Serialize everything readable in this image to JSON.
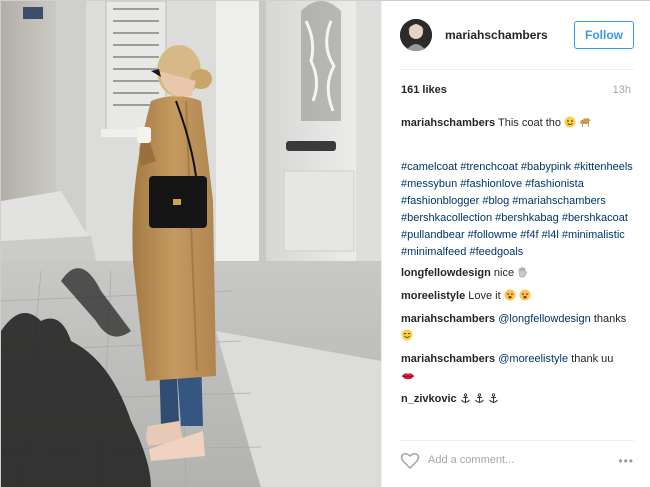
{
  "post": {
    "username": "mariahschambers",
    "follow_label": "Follow",
    "likes": "161 likes",
    "time": "13h",
    "caption": {
      "user": "mariahschambers",
      "text": "This coat tho"
    },
    "hashtags": "#camelcoat #trenchcoat #babypink #kittenheels #messybun #fashionlove #fashionista #fashionblogger #blog #mariahschambers #bershkacollection #bershkabag #bershkacoat #pullandbear #followme #f4f #l4l #minimalistic #minimalfeed #feedgoals",
    "comments": [
      {
        "user": "longfellowdesign",
        "text": "nice"
      },
      {
        "user": "moreelistyle",
        "text": "Love it"
      },
      {
        "user": "mariahschambers",
        "mention": "@longfellowdesign",
        "text": "thanks"
      },
      {
        "user": "mariahschambers",
        "mention": "@moreelistyle",
        "text": "thank uu"
      },
      {
        "user": "n_zivkovic",
        "text": ""
      }
    ],
    "add_comment_placeholder": "Add a comment...",
    "more_label": "•••"
  },
  "colors": {
    "link": "#003569",
    "follow": "#3897f0",
    "muted": "#a5a5a5"
  },
  "icons": [
    "heart-icon",
    "more-icon",
    "avatar"
  ]
}
